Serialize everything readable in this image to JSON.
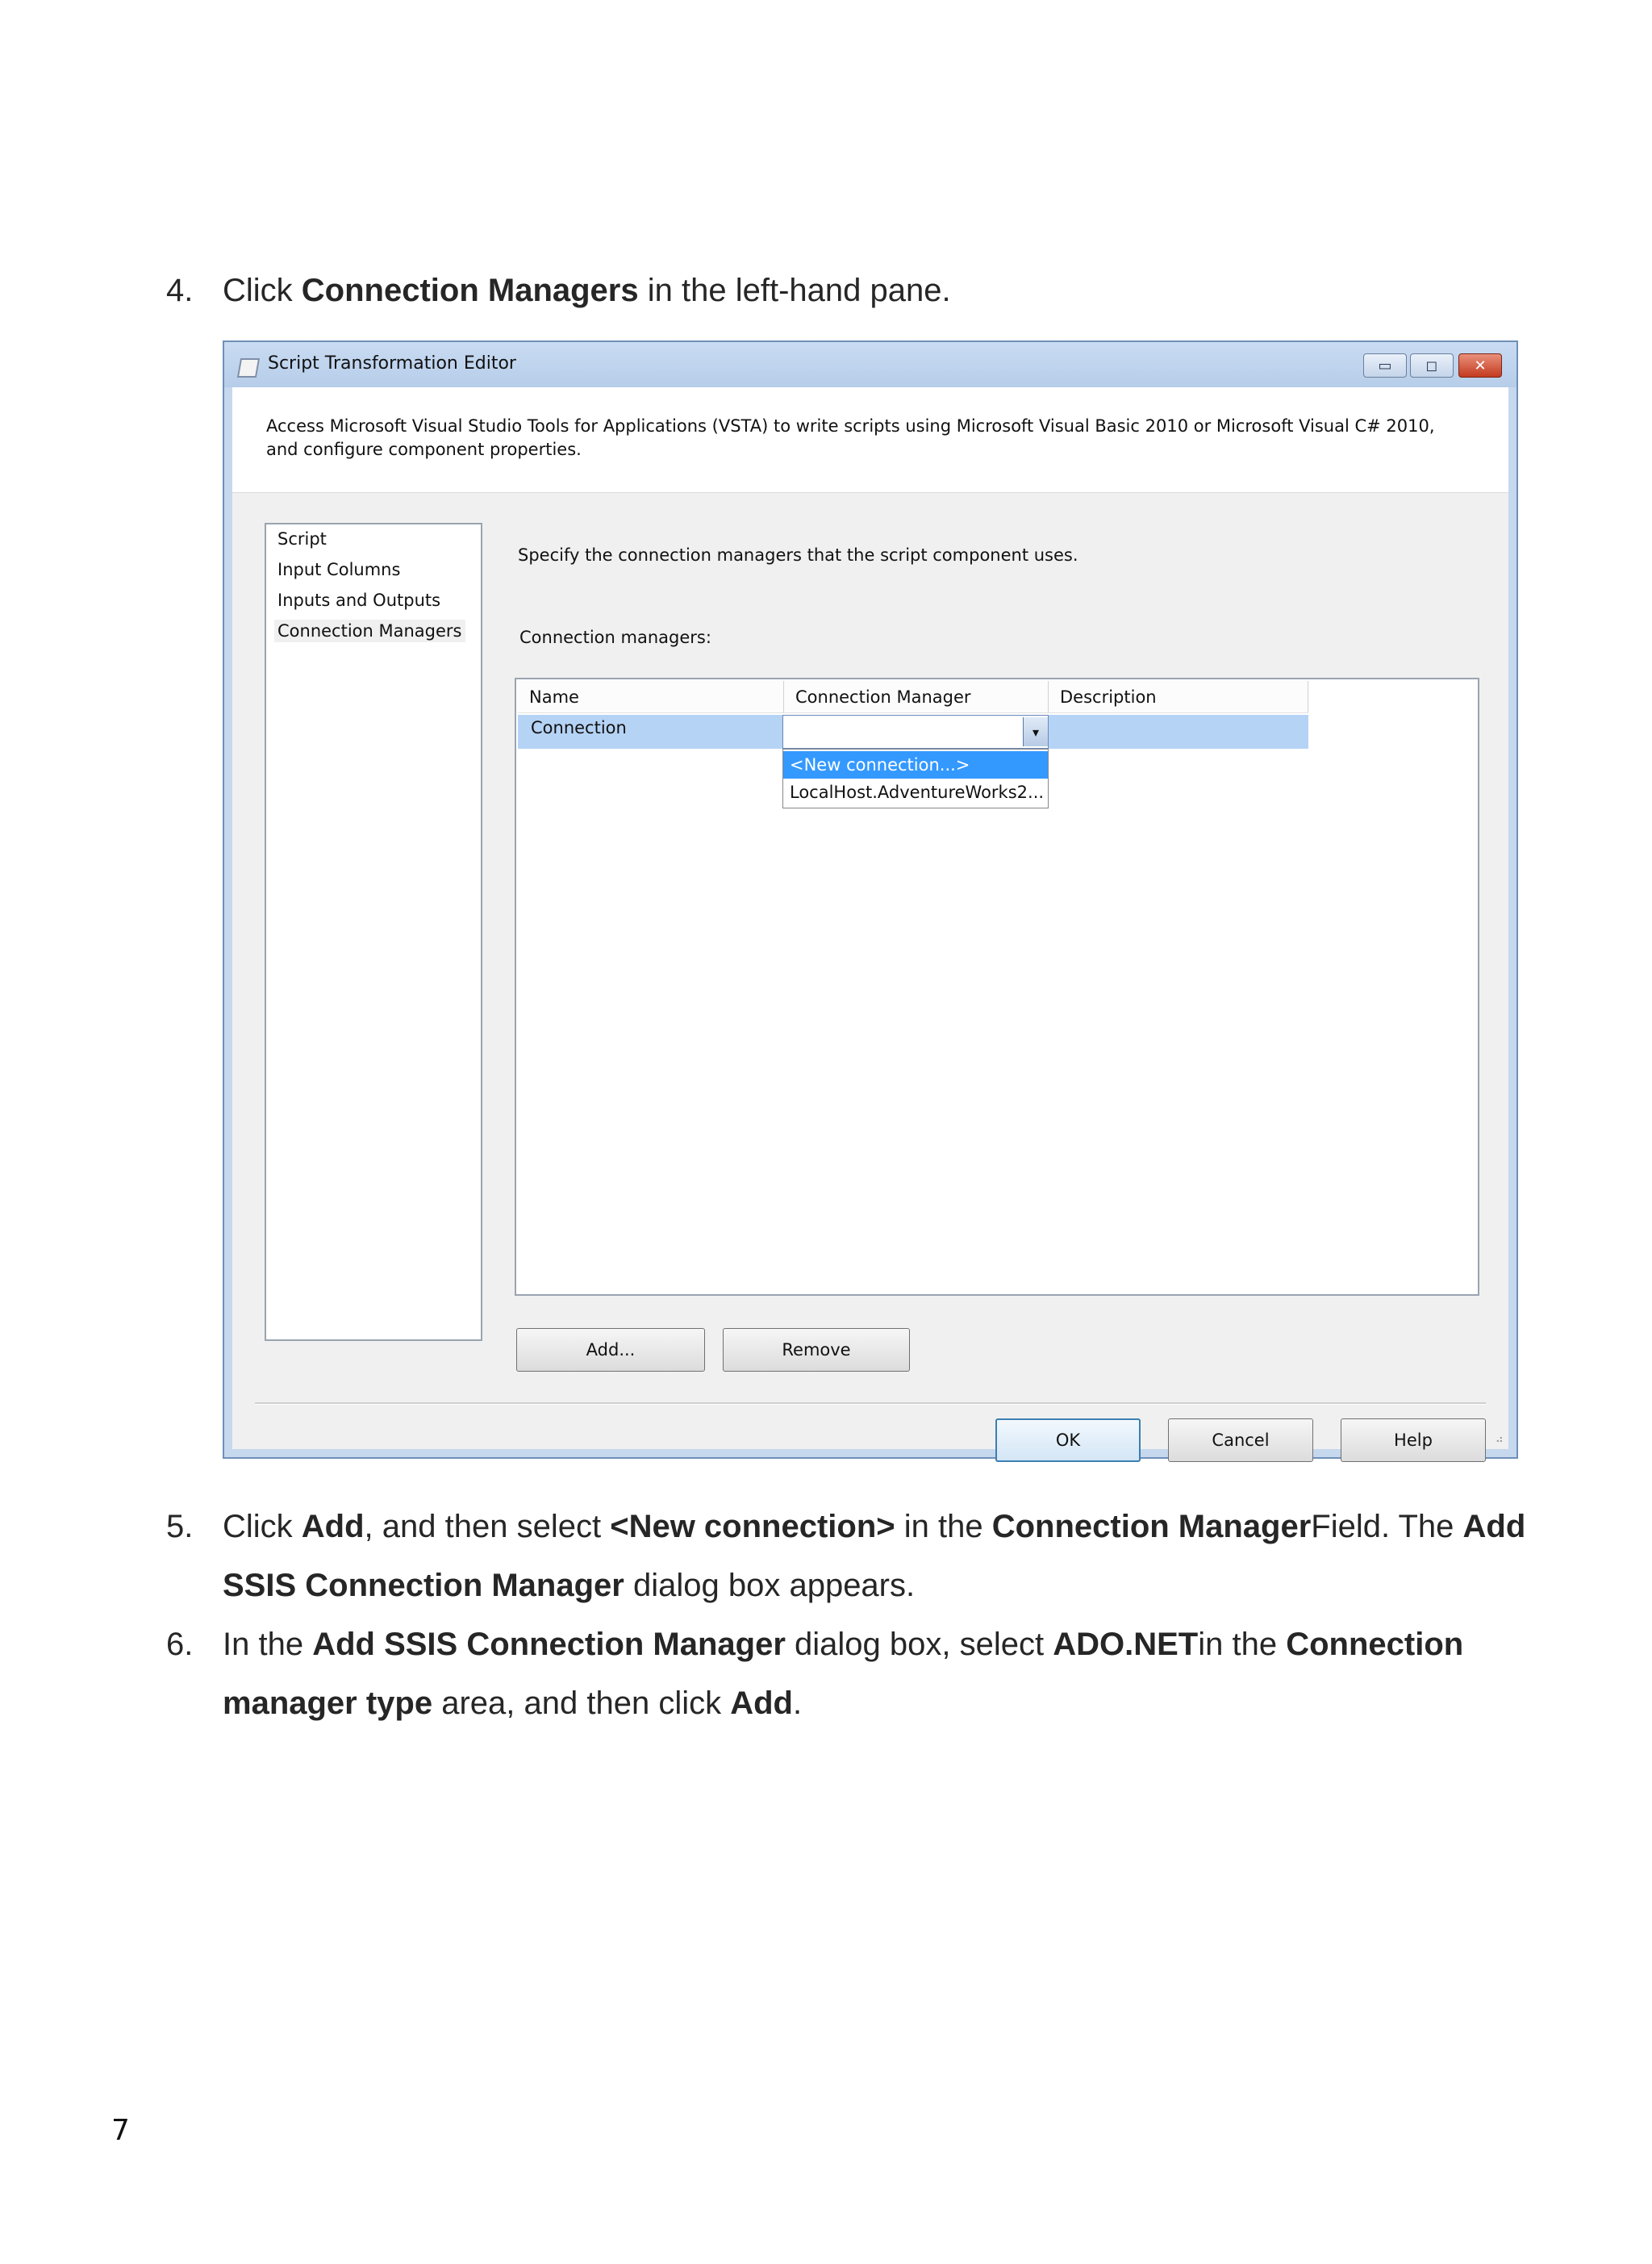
{
  "steps": {
    "step4": {
      "number": "4.",
      "parts": [
        "Click ",
        "Connection Managers",
        " in the left-hand pane."
      ]
    },
    "step5": {
      "number": "5.",
      "parts": [
        "Click ",
        "Add",
        ", and then select ",
        "<New connection>",
        " in the ",
        "Connection Manager",
        "Field. The ",
        "Add SSIS Connection Manager",
        " dialog box appears."
      ]
    },
    "step6": {
      "number": "6.",
      "parts": [
        "In the ",
        "Add SSIS Connection Manager",
        " dialog box, select ",
        "ADO.NET",
        "in the ",
        "Connection manager type",
        " area, and then click ",
        "Add",
        "."
      ]
    }
  },
  "dialog": {
    "title": "Script Transformation Editor",
    "window_buttons": [
      "▭",
      "◻",
      "✕"
    ],
    "description": "Access Microsoft Visual Studio Tools for Applications (VSTA) to write scripts using Microsoft Visual Basic 2010 or Microsoft Visual C# 2010, and configure component properties.",
    "nav_items": [
      "Script",
      "Input Columns",
      "Inputs and Outputs",
      "Connection Managers"
    ],
    "panel_description": "Specify the connection managers that the script component uses.",
    "connection_managers_label": "Connection managers:",
    "columns": [
      "Name",
      "Connection Manager",
      "Description"
    ],
    "row": {
      "name": "Connection",
      "connection_manager": ""
    },
    "dropdown_arrow": "▾",
    "dropdown_options": [
      "<New connection...>",
      "LocalHost.AdventureWorks2..."
    ],
    "buttons": {
      "add": "Add...",
      "remove": "Remove",
      "ok": "OK",
      "cancel": "Cancel",
      "help": "Help"
    },
    "grip": "⠴"
  },
  "page_number": "7"
}
